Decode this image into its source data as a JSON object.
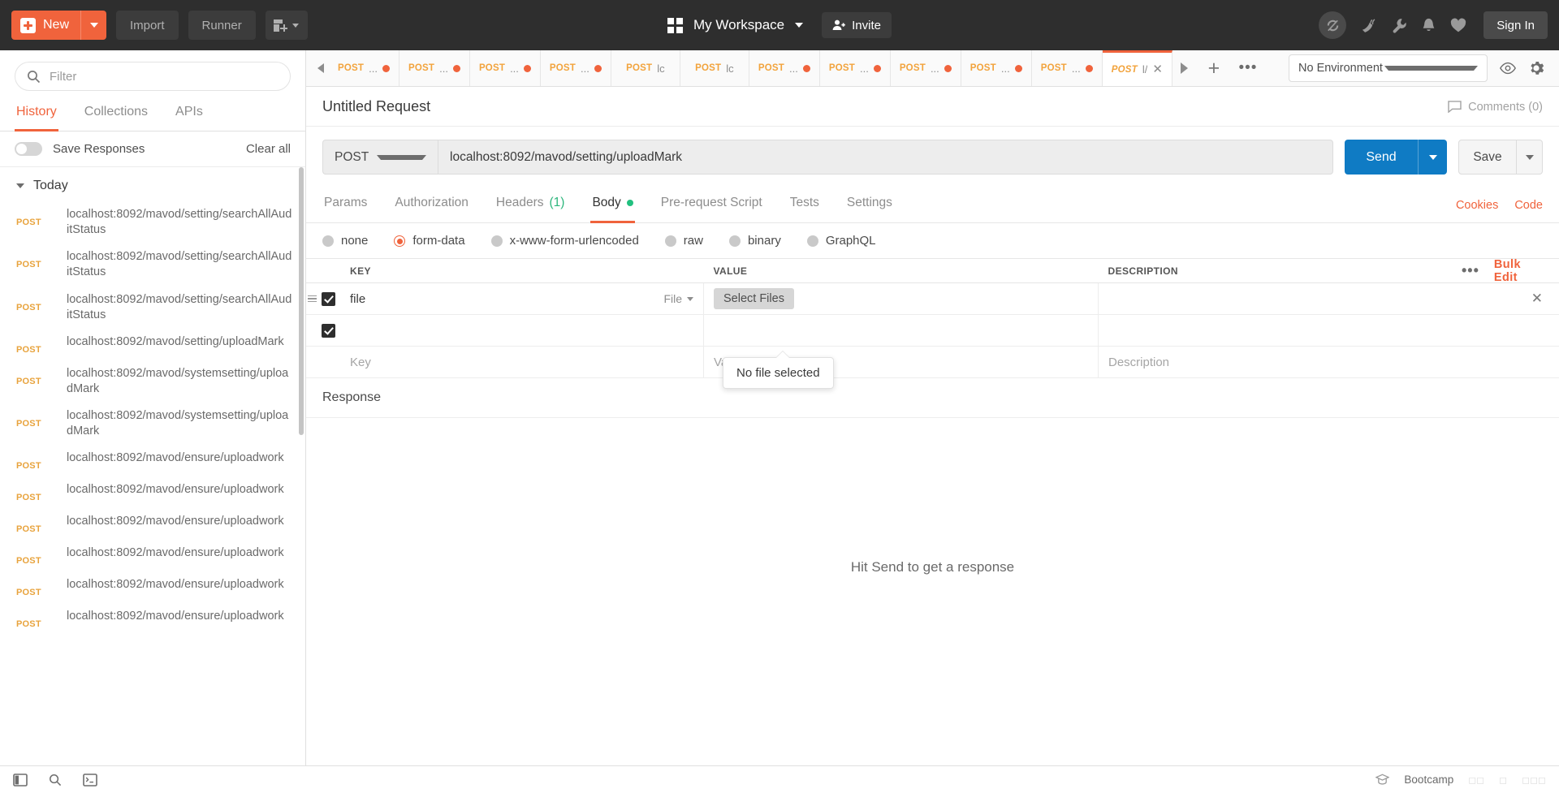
{
  "topbar": {
    "new_label": "New",
    "import_label": "Import",
    "runner_label": "Runner",
    "workspace_name": "My Workspace",
    "invite_label": "Invite",
    "signin_label": "Sign In",
    "icons": [
      "new-collection-icon",
      "sync-off-icon",
      "broadcast-icon",
      "wrench-icon",
      "bell-icon",
      "heart-icon"
    ]
  },
  "sidebar": {
    "filter_placeholder": "Filter",
    "tabs": [
      {
        "label": "History",
        "active": true
      },
      {
        "label": "Collections",
        "active": false
      },
      {
        "label": "APIs",
        "active": false
      }
    ],
    "save_responses_label": "Save Responses",
    "clear_all_label": "Clear all",
    "group_title": "Today",
    "history": [
      {
        "method": "POST",
        "url": "localhost:8092/mavod/setting/searchAllAuditStatus"
      },
      {
        "method": "POST",
        "url": "localhost:8092/mavod/setting/searchAllAuditStatus"
      },
      {
        "method": "POST",
        "url": "localhost:8092/mavod/setting/searchAllAuditStatus"
      },
      {
        "method": "POST",
        "url": "localhost:8092/mavod/setting/uploadMark"
      },
      {
        "method": "POST",
        "url": "localhost:8092/mavod/systemsetting/uploadMark"
      },
      {
        "method": "POST",
        "url": "localhost:8092/mavod/systemsetting/uploadMark"
      },
      {
        "method": "POST",
        "url": "localhost:8092/mavod/ensure/uploadwork"
      },
      {
        "method": "POST",
        "url": "localhost:8092/mavod/ensure/uploadwork"
      },
      {
        "method": "POST",
        "url": "localhost:8092/mavod/ensure/uploadwork"
      },
      {
        "method": "POST",
        "url": "localhost:8092/mavod/ensure/uploadwork"
      },
      {
        "method": "POST",
        "url": "localhost:8092/mavod/ensure/uploadwork"
      },
      {
        "method": "POST",
        "url": "localhost:8092/mavod/ensure/uploadwork"
      }
    ]
  },
  "tabstrip": {
    "tabs": [
      {
        "method": "POST",
        "title": "...",
        "unsaved": true,
        "active": false
      },
      {
        "method": "POST",
        "title": "...",
        "unsaved": true,
        "active": false
      },
      {
        "method": "POST",
        "title": "...",
        "unsaved": true,
        "active": false
      },
      {
        "method": "POST",
        "title": "...",
        "unsaved": true,
        "active": false
      },
      {
        "method": "POST",
        "title": "lc",
        "unsaved": false,
        "active": false
      },
      {
        "method": "POST",
        "title": "lc",
        "unsaved": false,
        "active": false
      },
      {
        "method": "POST",
        "title": "...",
        "unsaved": true,
        "active": false
      },
      {
        "method": "POST",
        "title": "...",
        "unsaved": true,
        "active": false
      },
      {
        "method": "POST",
        "title": "...",
        "unsaved": true,
        "active": false
      },
      {
        "method": "POST",
        "title": "...",
        "unsaved": true,
        "active": false
      },
      {
        "method": "POST",
        "title": "...",
        "unsaved": true,
        "active": false
      },
      {
        "method": "POST",
        "title": "l/",
        "unsaved": false,
        "active": true
      }
    ],
    "add_label": "+",
    "more_label": "•••",
    "environment": "No Environment"
  },
  "request": {
    "title": "Untitled Request",
    "comments_label": "Comments (0)",
    "method": "POST",
    "url": "localhost:8092/mavod/setting/uploadMark",
    "send_label": "Send",
    "save_label": "Save",
    "tabs": [
      {
        "label": "Params",
        "active": false
      },
      {
        "label": "Authorization",
        "active": false
      },
      {
        "label": "Headers",
        "count": "(1)",
        "active": false
      },
      {
        "label": "Body",
        "active": true,
        "dot": true
      },
      {
        "label": "Pre-request Script",
        "active": false
      },
      {
        "label": "Tests",
        "active": false
      },
      {
        "label": "Settings",
        "active": false
      }
    ],
    "links": [
      "Cookies",
      "Code"
    ],
    "body_types": [
      {
        "label": "none",
        "selected": false
      },
      {
        "label": "form-data",
        "selected": true
      },
      {
        "label": "x-www-form-urlencoded",
        "selected": false
      },
      {
        "label": "raw",
        "selected": false
      },
      {
        "label": "binary",
        "selected": false
      },
      {
        "label": "GraphQL",
        "selected": false
      }
    ],
    "table": {
      "headers": {
        "key": "KEY",
        "value": "VALUE",
        "description": "DESCRIPTION"
      },
      "bulk_edit_label": "Bulk Edit",
      "rows": [
        {
          "checked": true,
          "key": "file",
          "type": "File",
          "value_button": "Select Files",
          "description": ""
        },
        {
          "checked": true,
          "key": "",
          "type": "",
          "value_button": "",
          "description": ""
        }
      ],
      "placeholders": {
        "key": "Key",
        "value": "Value",
        "description": "Description"
      }
    },
    "tooltip": "No file selected"
  },
  "response": {
    "heading": "Response",
    "empty_message": "Hit Send to get a response"
  },
  "statusbar": {
    "bootcamp_label": "Bootcamp",
    "icons": [
      "sidebar-toggle-icon",
      "search-icon",
      "console-icon",
      "runner-icon",
      "trash-icon",
      "help-icon",
      "settings-icon"
    ]
  },
  "colors": {
    "accent": "#f0633c",
    "method": "#f2a33c",
    "send": "#0f7bc4",
    "green": "#22c07f"
  }
}
